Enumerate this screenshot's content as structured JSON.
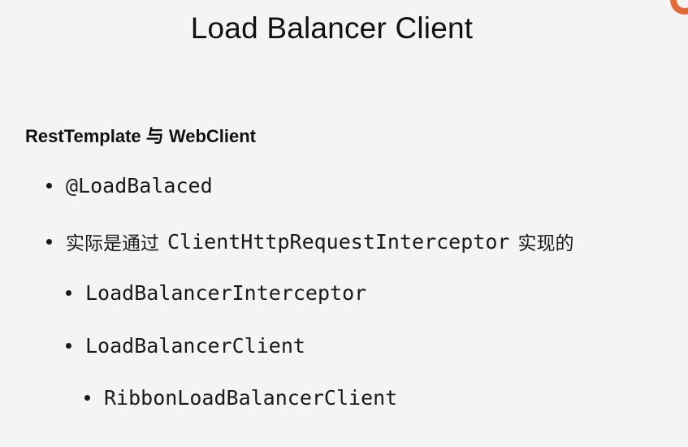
{
  "slide": {
    "title": "Load Balancer Client",
    "heading": "RestTemplate 与 WebClient",
    "bullets": [
      {
        "text": "@LoadBalaced"
      },
      {
        "prefix": "实际是通过",
        "code": "ClientHttpRequestInterceptor",
        "suffix": "实现的"
      },
      {
        "text": "LoadBalancerInterceptor"
      },
      {
        "text": "LoadBalancerClient"
      },
      {
        "text": "RibbonLoadBalancerClient"
      }
    ]
  },
  "colors": {
    "background": "#f4f4f4",
    "text": "#1a1a1a",
    "corner_accent": "#e56a3a"
  }
}
